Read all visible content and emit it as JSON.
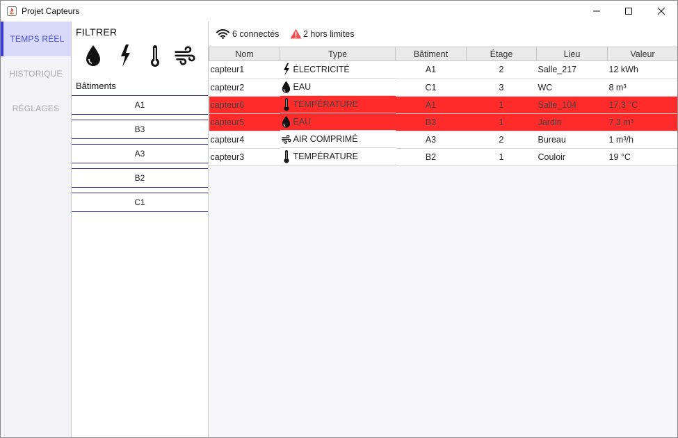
{
  "window": {
    "title": "Projet Capteurs"
  },
  "nav": {
    "items": [
      {
        "label": "TEMPS RÉEL",
        "active": true
      },
      {
        "label": "HISTORIQUE",
        "active": false
      },
      {
        "label": "RÉGLAGES",
        "active": false
      }
    ]
  },
  "filter": {
    "title": "FILTRER",
    "icons": [
      "water-drop-icon",
      "lightning-icon",
      "thermometer-icon",
      "wind-icon"
    ],
    "buildings_title": "Bâtiments",
    "buildings": [
      "A1",
      "B3",
      "A3",
      "B2",
      "C1"
    ]
  },
  "status": {
    "connected": "6 connectés",
    "alerts": "2 hors limites",
    "alert_color": "#f05050"
  },
  "table": {
    "headers": [
      "Nom",
      "Type",
      "Bâtiment",
      "Étage",
      "Lieu",
      "Valeur"
    ],
    "rows": [
      {
        "nom": "capteur1",
        "icon": "lightning",
        "type": "ÉLECTRICITÉ",
        "batiment": "A1",
        "etage": "2",
        "lieu": "Salle_217",
        "valeur": "12 kWh",
        "alert": false
      },
      {
        "nom": "capteur2",
        "icon": "drop",
        "type": "EAU",
        "batiment": "C1",
        "etage": "3",
        "lieu": "WC",
        "valeur": "8 m³",
        "alert": false
      },
      {
        "nom": "capteur6",
        "icon": "thermo",
        "type": "TEMPÉRATURE",
        "batiment": "A1",
        "etage": "1",
        "lieu": "Salle_104",
        "valeur": "17,3 °C",
        "alert": true
      },
      {
        "nom": "capteur5",
        "icon": "drop",
        "type": "EAU",
        "batiment": "B3",
        "etage": "1",
        "lieu": "Jardin",
        "valeur": "7,3 m³",
        "alert": true
      },
      {
        "nom": "capteur4",
        "icon": "wind",
        "type": "AIR COMPRIMÉ",
        "batiment": "A3",
        "etage": "2",
        "lieu": "Bureau",
        "valeur": "1 m³/h",
        "alert": false
      },
      {
        "nom": "capteur3",
        "icon": "thermo",
        "type": "TEMPÉRATURE",
        "batiment": "B2",
        "etage": "1",
        "lieu": "Couloir",
        "valeur": "19 °C",
        "alert": false
      }
    ],
    "alert_row_color": "#ff2b2b"
  }
}
